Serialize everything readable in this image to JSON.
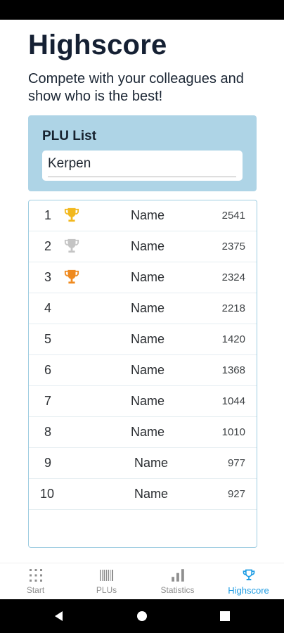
{
  "header": {
    "title": "Highscore",
    "subtitle": "Compete with your colleagues and show who is the best!"
  },
  "plu": {
    "label": "PLU List",
    "value": "Kerpen"
  },
  "rows": [
    {
      "rank": "1",
      "name": "Name",
      "score": "2541",
      "trophy": "gold-trophy-icon"
    },
    {
      "rank": "2",
      "name": "Name",
      "score": "2375",
      "trophy": "silver-trophy-icon"
    },
    {
      "rank": "3",
      "name": "Name",
      "score": "2324",
      "trophy": "bronze-trophy-icon"
    },
    {
      "rank": "4",
      "name": "Name",
      "score": "2218"
    },
    {
      "rank": "5",
      "name": "Name",
      "score": "1420"
    },
    {
      "rank": "6",
      "name": "Name",
      "score": "1368"
    },
    {
      "rank": "7",
      "name": "Name",
      "score": "1044"
    },
    {
      "rank": "8",
      "name": "Name",
      "score": "1010"
    },
    {
      "rank": "9",
      "name": "Name",
      "score": "977"
    },
    {
      "rank": "10",
      "name": "Name",
      "score": "927"
    }
  ],
  "colors": {
    "gold": "#f2b81e",
    "silver": "#c4c4c4",
    "bronze": "#ef8a1f",
    "accent": "#1c9be3",
    "card": "#aed4e6"
  },
  "nav": {
    "items": [
      {
        "label": "Start",
        "icon": "grid-icon"
      },
      {
        "label": "PLUs",
        "icon": "barcode-icon"
      },
      {
        "label": "Statistics",
        "icon": "bar-chart-icon"
      },
      {
        "label": "Highscore",
        "icon": "trophy-icon",
        "active": true
      }
    ]
  }
}
